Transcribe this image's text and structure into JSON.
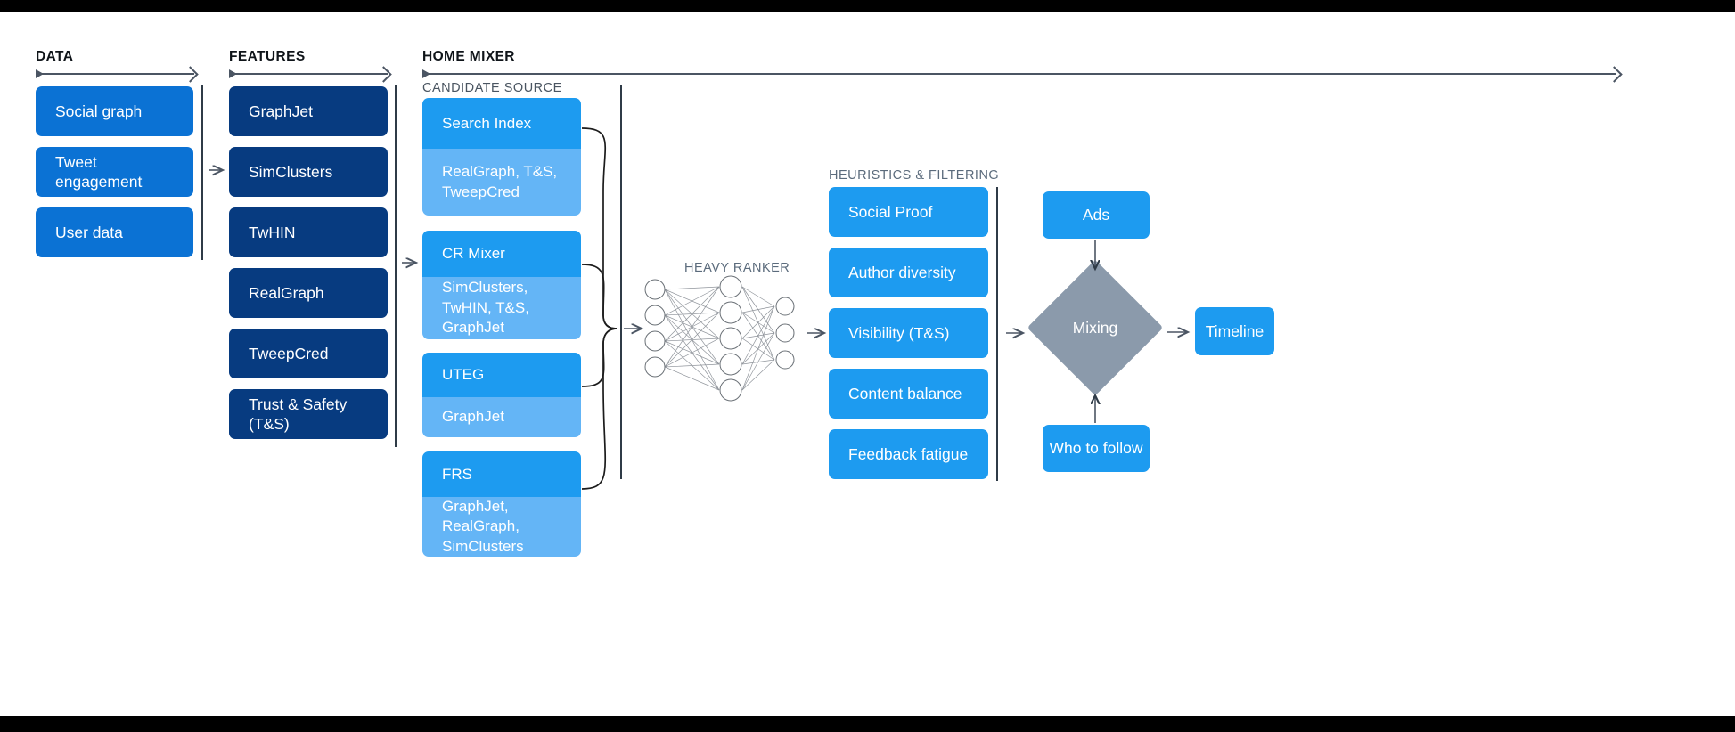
{
  "sections": {
    "data": {
      "title": "DATA"
    },
    "features": {
      "title": "FEATURES"
    },
    "home_mixer": {
      "title": "HOME MIXER"
    },
    "candidate_source": {
      "title": "CANDIDATE SOURCE"
    },
    "heavy_ranker": {
      "title": "HEAVY RANKER"
    },
    "heuristics": {
      "title": "HEURISTICS & FILTERING"
    }
  },
  "data_items": [
    {
      "label": "Social graph"
    },
    {
      "label": "Tweet engagement"
    },
    {
      "label": "User data"
    }
  ],
  "feature_items": [
    {
      "label": "GraphJet"
    },
    {
      "label": "SimClusters"
    },
    {
      "label": "TwHIN"
    },
    {
      "label": "RealGraph"
    },
    {
      "label": "TweepCred"
    },
    {
      "label": "Trust & Safety (T&S)"
    }
  ],
  "candidate_sources": [
    {
      "name": "Search Index",
      "features": "RealGraph, T&S, TweepCred"
    },
    {
      "name": "CR Mixer",
      "features": "SimClusters, TwHIN, T&S, GraphJet"
    },
    {
      "name": "UTEG",
      "features": "GraphJet"
    },
    {
      "name": "FRS",
      "features": "GraphJet, RealGraph, SimClusters"
    }
  ],
  "heuristic_items": [
    {
      "label": "Social Proof"
    },
    {
      "label": "Author diversity"
    },
    {
      "label": "Visibility (T&S)"
    },
    {
      "label": "Content balance"
    },
    {
      "label": "Feedback fatigue"
    }
  ],
  "mixing": {
    "ads_label": "Ads",
    "mixing_label": "Mixing",
    "who_to_follow_label": "Who to follow",
    "timeline_label": "Timeline"
  },
  "neural_net": {
    "input_nodes": 4,
    "hidden_nodes": 5,
    "output_nodes": 3
  },
  "colors": {
    "data_blue": "#0b72d4",
    "feature_navy": "#073b80",
    "bright_blue": "#1d9bf0",
    "light_blue": "#64b5f6",
    "diamond_gray": "#8b9aab",
    "rule_gray": "#4b5563",
    "text_dark": "#0f1419"
  }
}
